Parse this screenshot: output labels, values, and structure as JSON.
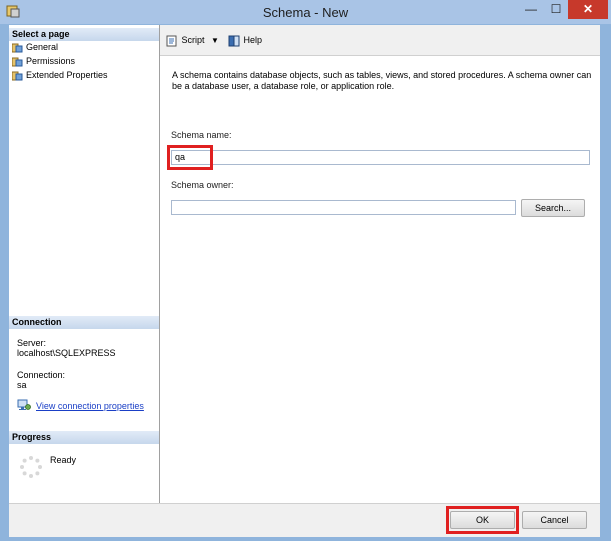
{
  "window": {
    "title": "Schema - New",
    "min_glyph": "—",
    "max_glyph": "☐",
    "close_glyph": "✕"
  },
  "left_pane": {
    "select_page_header": "Select a page",
    "pages": [
      {
        "label": "General"
      },
      {
        "label": "Permissions"
      },
      {
        "label": "Extended Properties"
      }
    ],
    "connection_header": "Connection",
    "server_label": "Server:",
    "server_value": "localhost\\SQLEXPRESS",
    "connection_label": "Connection:",
    "connection_value": "sa",
    "view_connection_link": "View connection properties",
    "progress_header": "Progress",
    "progress_status": "Ready"
  },
  "toolbar": {
    "script_label": "Script",
    "help_label": "Help"
  },
  "general": {
    "description": "A schema contains database objects, such as tables, views, and stored procedures. A schema owner can be a database user, a database role, or application role.",
    "schema_name_label": "Schema name:",
    "schema_name_value": "qa",
    "schema_owner_label": "Schema owner:",
    "schema_owner_value": "",
    "search_button": "Search..."
  },
  "footer": {
    "ok_button": "OK",
    "cancel_button": "Cancel"
  },
  "colors": {
    "highlight": "#e02020",
    "link": "#1a3fc6",
    "close_button": "#c7392b"
  }
}
